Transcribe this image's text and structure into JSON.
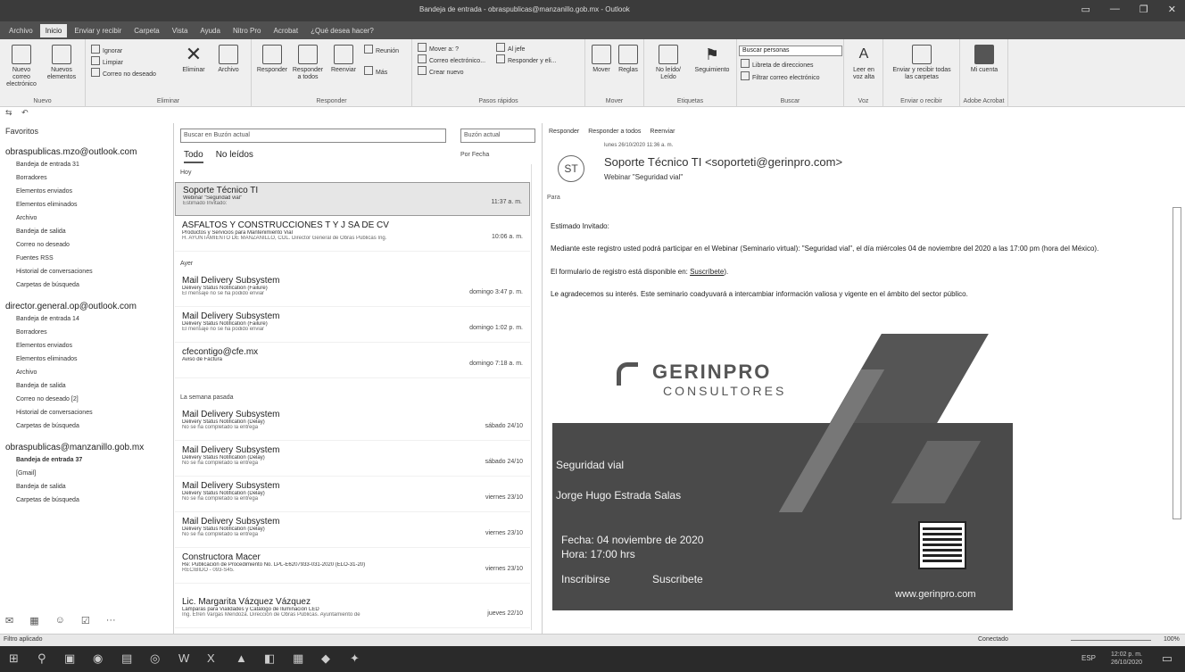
{
  "window": {
    "title": "Bandeja de entrada - obraspublicas@manzanillo.gob.mx - Outlook"
  },
  "menu": [
    "Archivo",
    "Inicio",
    "Enviar y recibir",
    "Carpeta",
    "Vista",
    "Ayuda",
    "Nitro Pro",
    "Acrobat",
    "¿Qué desea hacer?"
  ],
  "ribbon": {
    "nuevo": {
      "new_mail": "Nuevo correo electrónico",
      "new_items": "Nuevos elementos",
      "label": "Nuevo"
    },
    "eliminar": {
      "ignore": "Ignorar",
      "clean": "Limpiar",
      "junk": "Correo no deseado",
      "delete": "Eliminar",
      "archive": "Archivo",
      "label": "Eliminar"
    },
    "responder": {
      "reply": "Responder",
      "reply_all": "Responder a todos",
      "forward": "Reenviar",
      "meeting": "Reunión",
      "more": "Más",
      "label": "Responder"
    },
    "pasos": {
      "move_to": "Mover a: ?",
      "boss": "Al jefe",
      "team": "Correo electrónico...",
      "reply_delete": "Responder y eli...",
      "new": "Crear nuevo",
      "label": "Pasos rápidos"
    },
    "mover": {
      "move": "Mover",
      "rules": "Reglas",
      "label": "Mover"
    },
    "etiquetas": {
      "unread": "No leído/ Leído",
      "followup": "Seguimiento",
      "label": "Etiquetas"
    },
    "buscar": {
      "people": "Buscar personas",
      "address": "Libreta de direcciones",
      "filter": "Filtrar correo electrónico",
      "label": "Buscar"
    },
    "voz": {
      "read": "Leer en voz alta",
      "label": "Voz"
    },
    "enviar": {
      "send_all": "Enviar y recibir todas las carpetas",
      "label": "Enviar o recibir"
    },
    "acrobat": {
      "account": "Mi cuenta",
      "label": "Adobe Acrobat"
    }
  },
  "folders": {
    "favorites": "Favoritos",
    "accounts": [
      {
        "name": "obraspublicas.mzo@outlook.com",
        "items": [
          "Bandeja de entrada 31",
          "Borradores",
          "Elementos enviados",
          "Elementos eliminados",
          "Archivo",
          "Bandeja de salida",
          "Correo no deseado",
          "Fuentes RSS",
          "Historial de conversaciones",
          "Carpetas de búsqueda"
        ]
      },
      {
        "name": "director.general.op@outlook.com",
        "items": [
          "Bandeja de entrada 14",
          "Borradores",
          "Elementos enviados",
          "Elementos eliminados",
          "Archivo",
          "Bandeja de salida",
          "Correo no deseado [2]",
          "Historial de conversaciones",
          "Carpetas de búsqueda"
        ]
      },
      {
        "name": "obraspublicas@manzanillo.gob.mx",
        "items": [
          "Bandeja de entrada 37",
          "[Gmail]",
          "Bandeja de salida",
          "Carpetas de búsqueda"
        ]
      }
    ]
  },
  "list": {
    "search_placeholder": "Buscar en Buzón actual",
    "scope": "Buzón actual",
    "tab_all": "Todo",
    "tab_unread": "No leídos",
    "sort": "Por Fecha",
    "groups": {
      "today": "Hoy",
      "yesterday": "Ayer",
      "last_week": "La semana pasada"
    },
    "items": [
      {
        "sender": "Soporte Técnico TI",
        "subject": "Webinar \"Seguridad vial\"",
        "preview": "Estimado Invitado:",
        "date": "11:37 a. m."
      },
      {
        "sender": "ASFALTOS Y CONSTRUCCIONES T Y J SA DE CV",
        "subject": "Productos y Servicios para Mantenimiento Vial",
        "preview": "H. AYUNTAMIENTO DE MANZANILLO, COL. Director General de Obras Públicas Ing.",
        "date": "10:06 a. m."
      },
      {
        "sender": "Mail Delivery Subsystem",
        "subject": "Delivery Status Notification (Failure)",
        "preview": "El mensaje no se ha podido enviar",
        "date": "domingo 3:47 p. m."
      },
      {
        "sender": "Mail Delivery Subsystem",
        "subject": "Delivery Status Notification (Failure)",
        "preview": "El mensaje no se ha podido enviar",
        "date": "domingo 1:02 p. m."
      },
      {
        "sender": "cfecontigo@cfe.mx",
        "subject": "Aviso de Factura",
        "preview": "",
        "date": "domingo 7:18 a. m."
      },
      {
        "sender": "Mail Delivery Subsystem",
        "subject": "Delivery Status Notification (Delay)",
        "preview": "No se ha completado la entrega",
        "date": "sábado 24/10"
      },
      {
        "sender": "Mail Delivery Subsystem",
        "subject": "Delivery Status Notification (Delay)",
        "preview": "No se ha completado la entrega",
        "date": "sábado 24/10"
      },
      {
        "sender": "Mail Delivery Subsystem",
        "subject": "Delivery Status Notification (Delay)",
        "preview": "No se ha completado la entrega",
        "date": "viernes 23/10"
      },
      {
        "sender": "Mail Delivery Subsystem",
        "subject": "Delivery Status Notification (Delay)",
        "preview": "No se ha completado la entrega",
        "date": "viernes 23/10"
      },
      {
        "sender": "Constructora Macer",
        "subject": "Re: Publicación de Procedimiento No. LPL-E6207933-031-2020 (ELO-31-20)",
        "preview": "RECIBIDO - 093-S45.",
        "date": "viernes 23/10"
      },
      {
        "sender": "Lic. Margarita Vázquez Vázquez",
        "subject": "Lámparas para Vialidades y Catálogo de Iluminación LED",
        "preview": "Ing. Efrén Vargas Mendoza. Dirección de Obras Públicas. Ayuntamiento de",
        "date": "jueves 22/10"
      }
    ]
  },
  "reading": {
    "actions": [
      "Responder",
      "Responder a todos",
      "Reenviar"
    ],
    "avatar": "ST",
    "date": "lunes 26/10/2020 11:36 a. m.",
    "from": "Soporte Técnico TI <soporteti@gerinpro.com>",
    "subject": "Webinar \"Seguridad vial\"",
    "to_label": "Para",
    "greeting": "Estimado Invitado:",
    "p1": "Mediante este registro usted podrá participar en el Webinar (Seminario virtual): \"Seguridad vial\", el día miércoles 04 de noviembre del 2020 a las 17:00 pm (hora del México).",
    "p2_a": "El formulario de registro está disponible en: ",
    "p2_link": "Suscríbete",
    "p2_b": ").",
    "p3": "Le agradecemos su interés. Este seminario coadyuvará a intercambiar información valiosa y vigente en el ámbito del sector público.",
    "banner": {
      "brand": "GERINPRO",
      "brand_sub": "CONSULTORES",
      "topic": "Seguridad vial",
      "speaker": "Jorge Hugo Estrada Salas",
      "date_line": "Fecha: 04 noviembre de 2020",
      "time_line": "Hora: 17:00 hrs",
      "signup": "Inscribirse",
      "signup_btn": "Suscribete",
      "url": "www.gerinpro.com"
    }
  },
  "status": {
    "left": "Filtro aplicado",
    "right": "Conectado",
    "zoom": "100%"
  },
  "taskbar": {
    "time": "12:02 p. m.",
    "date": "26/10/2020",
    "lang": "ESP"
  }
}
